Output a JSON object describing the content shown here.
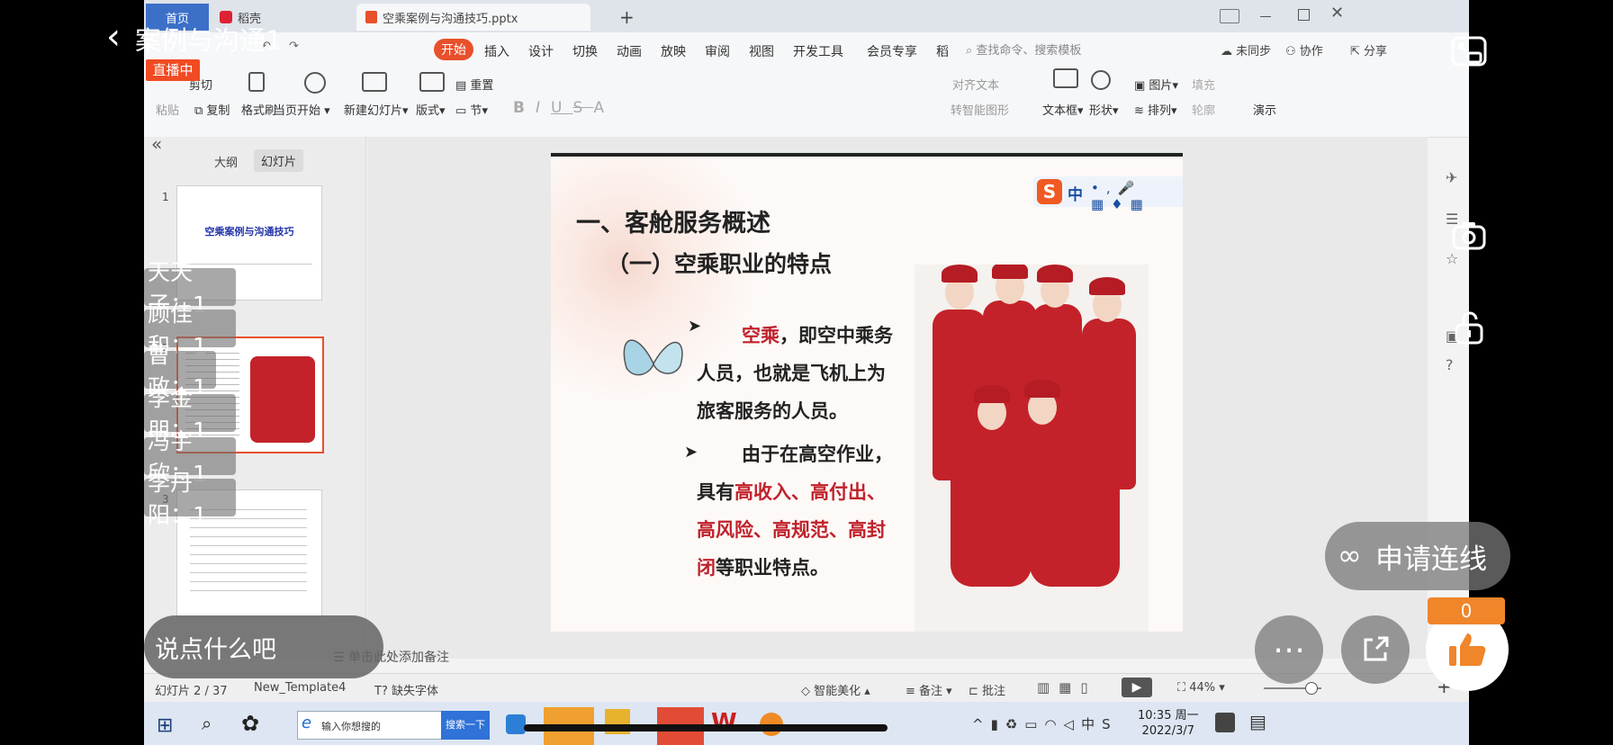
{
  "overlay": {
    "title": "案例与沟通1",
    "live_badge": "直播中",
    "chat_placeholder": "说点什么吧",
    "connect_button": "申请连线",
    "like_count": "0",
    "chats": [
      "天天子：1",
      "顾佳和：1",
      "曹政：1",
      "李金朋：1",
      "冯宇欣：1",
      "李丹阳：1"
    ]
  },
  "titlebar": {
    "tab_home": "首页",
    "tab_daoke": "稻壳",
    "tab_file": "空乘案例与沟通技巧.pptx",
    "new_tab": "+"
  },
  "menu": {
    "items": [
      "开始",
      "插入",
      "设计",
      "切换",
      "动画",
      "放映",
      "审阅",
      "视图",
      "开发工具",
      "会员专享",
      "稻"
    ],
    "search": "查找命令、搜索模板",
    "sync": "未同步",
    "collab": "协作",
    "share": "分享"
  },
  "ribbon": {
    "paste": "粘贴",
    "cut": "剪切",
    "copy": "复制",
    "format_painter": "格式刷",
    "from_current": "当页开始",
    "new_slide": "新建幻灯片",
    "layout": "版式",
    "section": "节",
    "reset": "重置",
    "align_text": "对齐文本",
    "smart_shape": "转智能图形",
    "textbox": "文本框",
    "shape": "形状",
    "picture": "图片",
    "fill": "填充",
    "arrange": "排列",
    "outline": "轮廓",
    "present": "演示"
  },
  "leftpanel": {
    "tab_outline": "大纲",
    "tab_slides": "幻灯片",
    "thumb1_title": "空乘案例与沟通技巧",
    "thumb_numbers": [
      "1",
      "2",
      "3"
    ]
  },
  "slide": {
    "heading": "一、客舱服务概述",
    "subheading": "（一）空乘职业的特点",
    "bullet1_red": "空乘",
    "bullet1_rest_a": "，即空中乘务",
    "bullet1_line2": "人员，也就是飞机上为",
    "bullet1_line3": "旅客服务的人员。",
    "bullet2_line1": "由于在高空作业，",
    "bullet2_line2a": "具有",
    "bullet2_line2b": "高收入、高付出、",
    "bullet2_line3": "高风险、高规范、高封",
    "bullet2_line4a": "闭",
    "bullet2_line4b": "等职业特点。",
    "ime_label": "中"
  },
  "notes": "单击此处添加备注",
  "status": {
    "slide_count": "幻灯片 2 / 37",
    "template": "New_Template4",
    "missing_font": "缺失字体",
    "smart_beautify": "智能美化",
    "notes_btn": "备注",
    "comment_btn": "批注",
    "zoom": "44%"
  },
  "taskbar": {
    "search_placeholder": "输入你想搜的",
    "search_button": "搜索一下",
    "time": "10:35 周一",
    "date": "2022/3/7"
  },
  "colors": {
    "accent_orange": "#e8502c",
    "slide_red": "#c0222c",
    "live_badge": "#f04b23",
    "like_badge": "#f0852a"
  }
}
